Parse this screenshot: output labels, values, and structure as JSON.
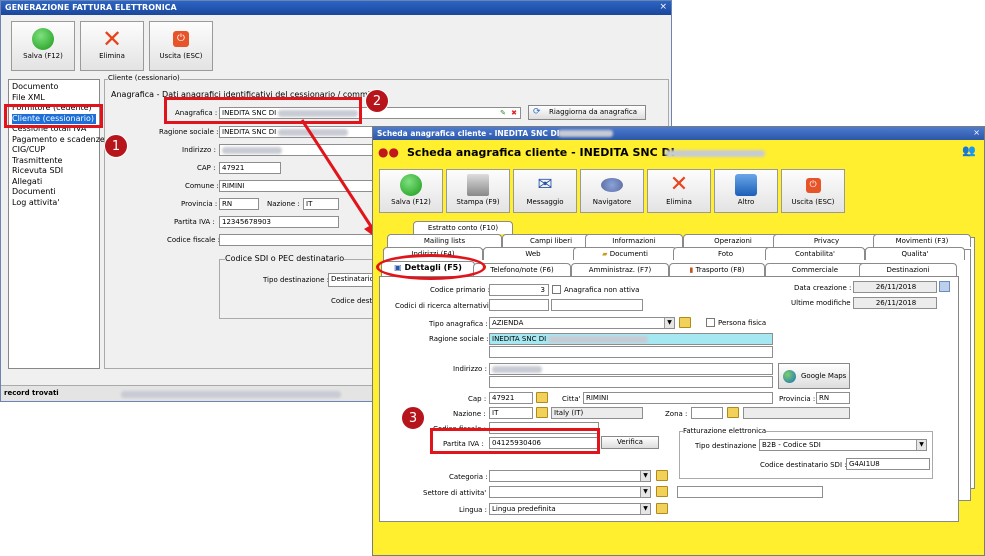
{
  "main_window": {
    "title": "GENERAZIONE FATTURA ELETTRONICA",
    "toolbar": [
      {
        "label": "Salva (F12)",
        "icon": "check-icon"
      },
      {
        "label": "Elimina",
        "icon": "x-icon"
      },
      {
        "label": "Uscita (ESC)",
        "icon": "exit-icon"
      }
    ],
    "menu": [
      "Documento",
      "File XML",
      "Formitore (cedente)",
      "Cliente (cessionario)",
      "Cessione totali IVA",
      "Pagamento e scadenze",
      "CIG/CUP",
      "Trasmittente",
      "Ricevuta SDI",
      "Allegati",
      "Documenti",
      "Log attivita'"
    ],
    "section_label": "Cliente (cessionario)",
    "group_label": "Anagrafica - Dati anagrafici identificativi del cessionario / committen",
    "fields": {
      "anagrafica_label": "Anagrafica :",
      "anagrafica_value": "INEDITA SNC DI",
      "ragione_sociale_label": "Ragione sociale :",
      "ragione_sociale_value": "INEDITA SNC DI",
      "indirizzo_label": "Indirizzo :",
      "cap_label": "CAP :",
      "cap_value": "47921",
      "comune_label": "Comune :",
      "comune_value": "RIMINI",
      "provincia_label": "Provincia :",
      "provincia_value": "RN",
      "nazione_label": "Nazione :",
      "nazione_value": "IT",
      "partita_iva_label": "Partita IVA :",
      "partita_iva_value": "12345678903",
      "codice_fiscale_label": "Codice fiscale :"
    },
    "rigguarda_button": "Riaggiorna da anagrafica",
    "sdi_group": "Codice SDI o PEC destinatario",
    "tipo_destinazione_label": "Tipo destinazione :",
    "tipo_destinazione_value": "Destinatario",
    "codice_destinatario_label": "Codice destin",
    "status": "record trovati"
  },
  "client_window": {
    "title": "Scheda anagrafica cliente - INEDITA SNC DI",
    "header": "Scheda anagrafica cliente - INEDITA SNC DI",
    "toolbar": [
      {
        "label": "Salva (F12)",
        "icon": "check-icon"
      },
      {
        "label": "Stampa (F9)",
        "icon": "printer-icon"
      },
      {
        "label": "Messaggio",
        "icon": "message-icon"
      },
      {
        "label": "Navigatore",
        "icon": "navigator-icon"
      },
      {
        "label": "Elimina",
        "icon": "x-icon"
      },
      {
        "label": "Altro",
        "icon": "altro-icon"
      },
      {
        "label": "Uscita (ESC)",
        "icon": "exit-icon"
      }
    ],
    "tabs_row1": [
      "Estratto conto (F10)"
    ],
    "tabs_row2": [
      "Mailing lists",
      "Campi liberi",
      "Informazioni",
      "Operazioni",
      "Privacy",
      "Movimenti (F3)"
    ],
    "tabs_row3": [
      "Indirizzi (F4)",
      "Web",
      "Documenti",
      "Foto",
      "Contabilita'",
      "Qualita'"
    ],
    "tabs_row4": [
      "Dettagli (F5)",
      "Telefono/note (F6)",
      "Amministraz. (F7)",
      "Trasporto (F8)",
      "Commerciale",
      "Destinazioni"
    ],
    "fields": {
      "codice_primario_label": "Codice primario :",
      "codice_primario_value": "3",
      "anagrafica_non_attiva": "Anagrafica non attiva",
      "codici_ricerca_label": "Codici di ricerca alternativi :",
      "data_creazione_label": "Data creazione :",
      "data_creazione_value": "26/11/2018",
      "ultime_modifiche_label": "Ultime modifiche :",
      "ultime_modifiche_value": "26/11/2018",
      "tipo_anagrafica_label": "Tipo anagrafica :",
      "tipo_anagrafica_value": "AZIENDA",
      "persona_fisica": "Persona fisica",
      "ragione_sociale_label": "Ragione sociale :",
      "ragione_sociale_value": "INEDITA SNC DI",
      "indirizzo_label": "Indirizzo :",
      "google_maps": "Google Maps",
      "cap_label": "Cap :",
      "cap_value": "47921",
      "citta_label": "Citta' :",
      "citta_value": "RIMINI",
      "provincia_label": "Provincia :",
      "provincia_value": "RN",
      "nazione_label": "Nazione :",
      "nazione_value": "IT",
      "nazione_desc": "Italy (IT)",
      "zona_label": "Zona :",
      "codice_fiscale_label": "Codice fiscale :",
      "partita_iva_label": "Partita IVA :",
      "partita_iva_value": "04125930406",
      "verifica": "Verifica",
      "fatturazione_group": "Fatturazione elettronica",
      "tipo_destinazione_label": "Tipo destinazione :",
      "tipo_destinazione_value": "B2B - Codice SDI",
      "codice_sdi_label": "Codice destinatario SDI :",
      "codice_sdi_value": "G4AI1U8",
      "categoria_label": "Categoria :",
      "settore_label": "Settore di attivita' :",
      "lingua_label": "Lingua :",
      "lingua_value": "Lingua predefinita"
    }
  },
  "badges": [
    "1",
    "2",
    "3"
  ],
  "colors": {
    "highlight_red": "#e0141a",
    "badge_red": "#b5151b",
    "client_bg": "#ffef2e",
    "titlebar_blue": "#1f4fa0"
  }
}
